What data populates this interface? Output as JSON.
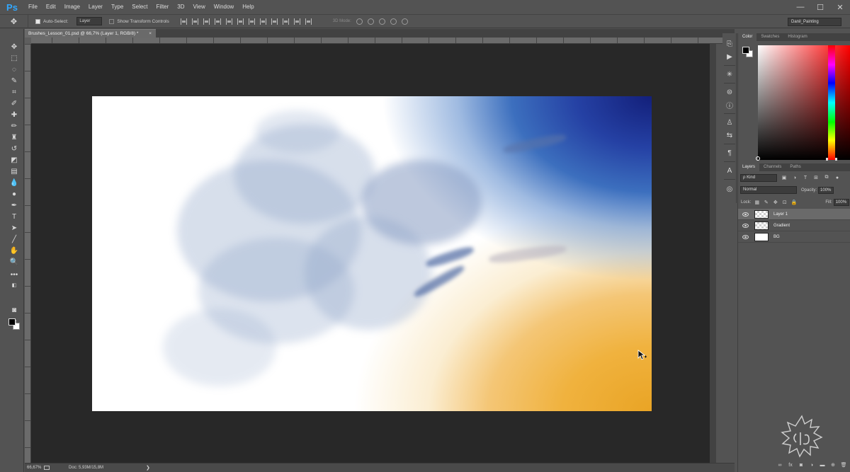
{
  "app": {
    "logo": "Ps"
  },
  "menu": [
    "File",
    "Edit",
    "Image",
    "Layer",
    "Type",
    "Select",
    "Filter",
    "3D",
    "View",
    "Window",
    "Help"
  ],
  "window_controls": {
    "minimize": "—",
    "maximize": "☐",
    "close": "✕"
  },
  "options_bar": {
    "auto_select_label": "Auto-Select:",
    "auto_select_target": "Layer",
    "transform_controls_label": "Show Transform Controls",
    "mode_3d_label": "3D Mode:",
    "workspace": "Danil_Painting"
  },
  "document": {
    "tab_title": "Brushes_Lesson_01.psd @ 66,7% (Layer 1, RGB/8) *",
    "close": "×"
  },
  "status_bar": {
    "zoom": "66,67%",
    "doc_info": "Doc: 5,93M/15,8M",
    "arrow": "❯"
  },
  "color_panel": {
    "tabs": [
      "Color",
      "Swatches",
      "Histogram"
    ],
    "foreground": "#000000",
    "background": "#ffffff"
  },
  "layers_panel": {
    "tabs": [
      "Layers",
      "Channels",
      "Paths"
    ],
    "filter_kind": "ρ Kind",
    "blend_mode": "Normal",
    "opacity_label": "Opacity:",
    "opacity_value": "100%",
    "lock_label": "Lock:",
    "fill_label": "Fill:",
    "fill_value": "100%",
    "layers": [
      {
        "name": "Layer 1",
        "selected": true,
        "thumb": "checker"
      },
      {
        "name": "Gradient",
        "selected": false,
        "thumb": "checker"
      },
      {
        "name": "BG",
        "selected": false,
        "thumb": "white"
      }
    ]
  },
  "colors": {
    "accent_blue": "#2541a4",
    "accent_orange": "#e9a425",
    "ps_logo": "#31a8ff"
  }
}
